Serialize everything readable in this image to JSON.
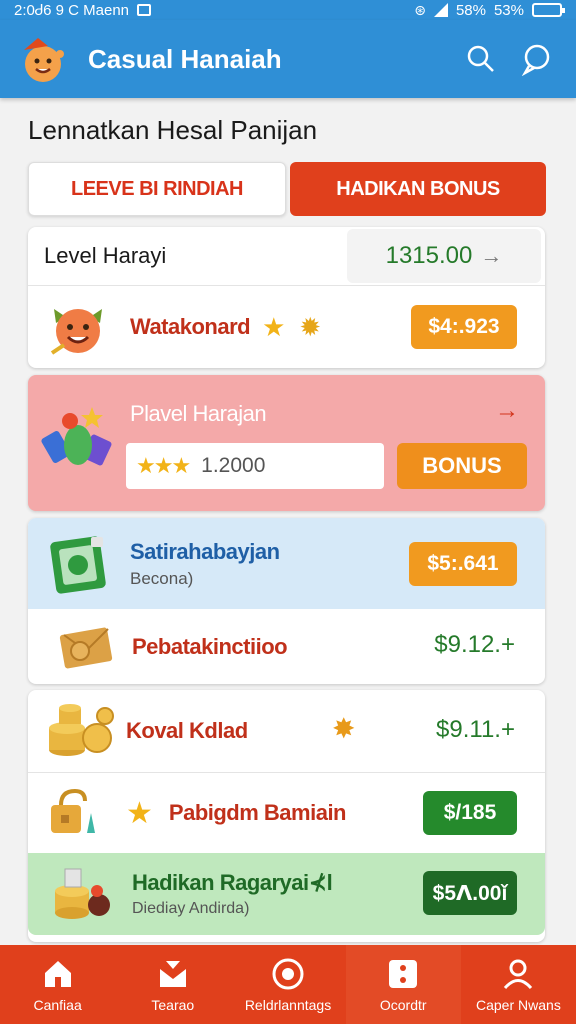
{
  "status_bar": {
    "time": "2:0Ꮷ6 9 C Maenn",
    "signal": "58%",
    "battery": "53%"
  },
  "app": {
    "title": "Casual Hanaiah"
  },
  "page": {
    "title": "Lennatkan Hesal Panijan"
  },
  "tabs": [
    {
      "label": "LEEVE BI RINDIAH",
      "active": false
    },
    {
      "label": "HADIKAN BONUS",
      "active": true
    }
  ],
  "level_row": {
    "label": "Level Harayi",
    "value": "1315.00",
    "arrow": "→"
  },
  "items": [
    {
      "name": "Watakonard",
      "amount": "$4:.923"
    },
    {
      "name": "Plavel Harajan",
      "arrow": "→",
      "input_value": "1.2000",
      "button": "BONUS"
    },
    {
      "name": "Satirahabayjan",
      "subtitle": "Becona)",
      "amount": "$5:.641"
    },
    {
      "name": "Pebatakinctiioo",
      "amount": "$9.12.+"
    },
    {
      "name": "Koval Kdlad",
      "amount": "$9.11.+"
    },
    {
      "name": "Pabigdm Bamiain",
      "amount": "$/185"
    },
    {
      "name": "Hadikan Ragaryai⊀l",
      "subtitle": "Diediay Andirda)",
      "amount": "$5ᐱ.00ǐ"
    }
  ],
  "bottom_nav": [
    {
      "label": "Canfiaa",
      "icon": "home-icon"
    },
    {
      "label": "Tearao",
      "icon": "inbox-icon"
    },
    {
      "label": "Reldrlanntags",
      "icon": "coin-icon"
    },
    {
      "label": "Ocordtr",
      "icon": "dice-icon",
      "active": true
    },
    {
      "label": "Caper Nwans",
      "icon": "profile-icon"
    }
  ],
  "colors": {
    "appbar": "#2f8fd6",
    "accent": "#e0401c",
    "pill_orange": "#f19a1f",
    "pill_green": "#258a2c",
    "pink_row": "#f4a9a9",
    "blue_row": "#d6e9f8",
    "green_row": "#bfe8bd"
  }
}
